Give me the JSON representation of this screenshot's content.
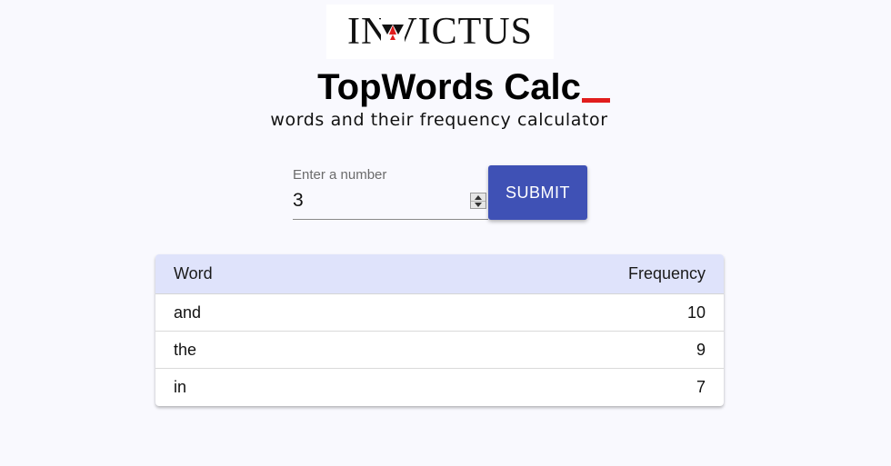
{
  "logo": {
    "text": "INVICTUS",
    "icon": "invictus-logo-mark"
  },
  "header": {
    "title": "TopWords Calc",
    "cursor_color": "#e11d1d",
    "subtitle": "words and their frequency calculator"
  },
  "form": {
    "label": "Enter a number",
    "value": "3",
    "submit_label": "SUBMIT",
    "submit_color": "#3f51b5"
  },
  "table": {
    "columns": [
      "Word",
      "Frequency"
    ],
    "header_color": "#dfe3fb",
    "rows": [
      {
        "word": "and",
        "frequency": "10"
      },
      {
        "word": "the",
        "frequency": "9"
      },
      {
        "word": "in",
        "frequency": "7"
      }
    ]
  }
}
